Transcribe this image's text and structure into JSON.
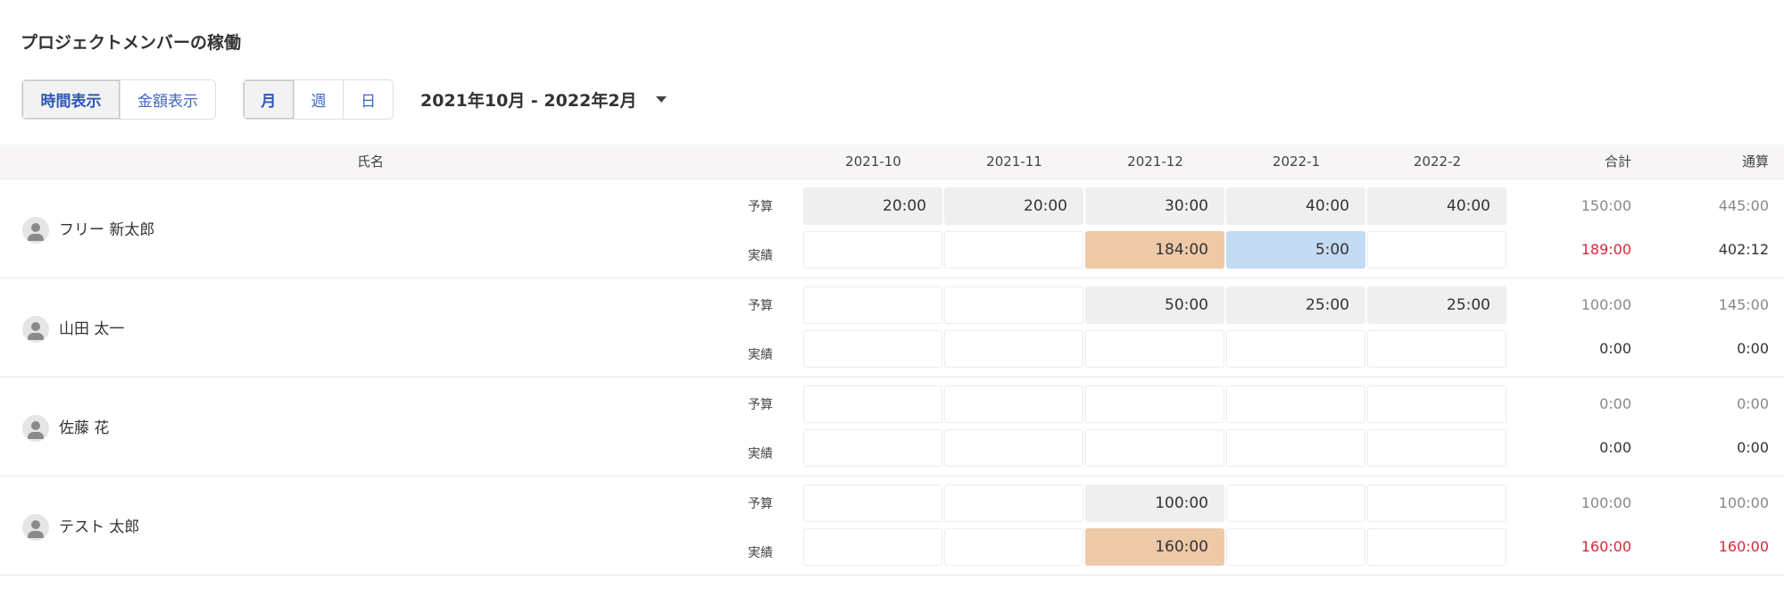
{
  "page": {
    "title": "プロジェクトメンバーの稼働"
  },
  "display_mode": {
    "options": [
      "時間表示",
      "金額表示"
    ],
    "selected": "時間表示"
  },
  "granularity": {
    "options": [
      "月",
      "週",
      "日"
    ],
    "selected": "月"
  },
  "period": {
    "label": "2021年10月 - 2022年2月"
  },
  "table": {
    "name_header": "氏名",
    "months": [
      "2021-10",
      "2021-11",
      "2021-12",
      "2022-1",
      "2022-2"
    ],
    "total_header": "合計",
    "cumulative_header": "通算",
    "row_labels": {
      "budget": "予算",
      "actual": "実績"
    },
    "members": [
      {
        "name": "フリー 新太郎",
        "budget": [
          "20:00",
          "20:00",
          "30:00",
          "40:00",
          "40:00"
        ],
        "budget_total": "150:00",
        "budget_cumulative": "445:00",
        "actual": [
          "",
          "",
          "184:00",
          "5:00",
          ""
        ],
        "actual_highlight": [
          "",
          "",
          "over",
          "under",
          ""
        ],
        "actual_total": "189:00",
        "actual_total_over": true,
        "actual_cumulative": "402:12",
        "actual_cumulative_over": false
      },
      {
        "name": "山田 太一",
        "budget": [
          "",
          "",
          "50:00",
          "25:00",
          "25:00"
        ],
        "budget_total": "100:00",
        "budget_cumulative": "145:00",
        "actual": [
          "",
          "",
          "",
          "",
          ""
        ],
        "actual_highlight": [
          "",
          "",
          "",
          "",
          ""
        ],
        "actual_total": "0:00",
        "actual_total_over": false,
        "actual_cumulative": "0:00",
        "actual_cumulative_over": false
      },
      {
        "name": "佐藤 花",
        "budget": [
          "",
          "",
          "",
          "",
          ""
        ],
        "budget_total": "0:00",
        "budget_cumulative": "0:00",
        "actual": [
          "",
          "",
          "",
          "",
          ""
        ],
        "actual_highlight": [
          "",
          "",
          "",
          "",
          ""
        ],
        "actual_total": "0:00",
        "actual_total_over": false,
        "actual_cumulative": "0:00",
        "actual_cumulative_over": false
      },
      {
        "name": "テスト 太郎",
        "budget": [
          "",
          "",
          "100:00",
          "",
          ""
        ],
        "budget_total": "100:00",
        "budget_cumulative": "100:00",
        "actual": [
          "",
          "",
          "160:00",
          "",
          ""
        ],
        "actual_highlight": [
          "",
          "",
          "over",
          "",
          ""
        ],
        "actual_total": "160:00",
        "actual_total_over": true,
        "actual_cumulative": "160:00",
        "actual_cumulative_over": true
      }
    ]
  },
  "colors": {
    "accent_blue": "#3f67c4",
    "over_budget_cell": "#edc9a8",
    "under_budget_cell": "#c3daf3",
    "over_budget_text": "#d5283a",
    "budget_cell": "#efefef",
    "header_bg": "#f7f5f5"
  },
  "icons": {
    "avatar": "person-avatar-icon",
    "period_dropdown": "caret-down-icon"
  }
}
